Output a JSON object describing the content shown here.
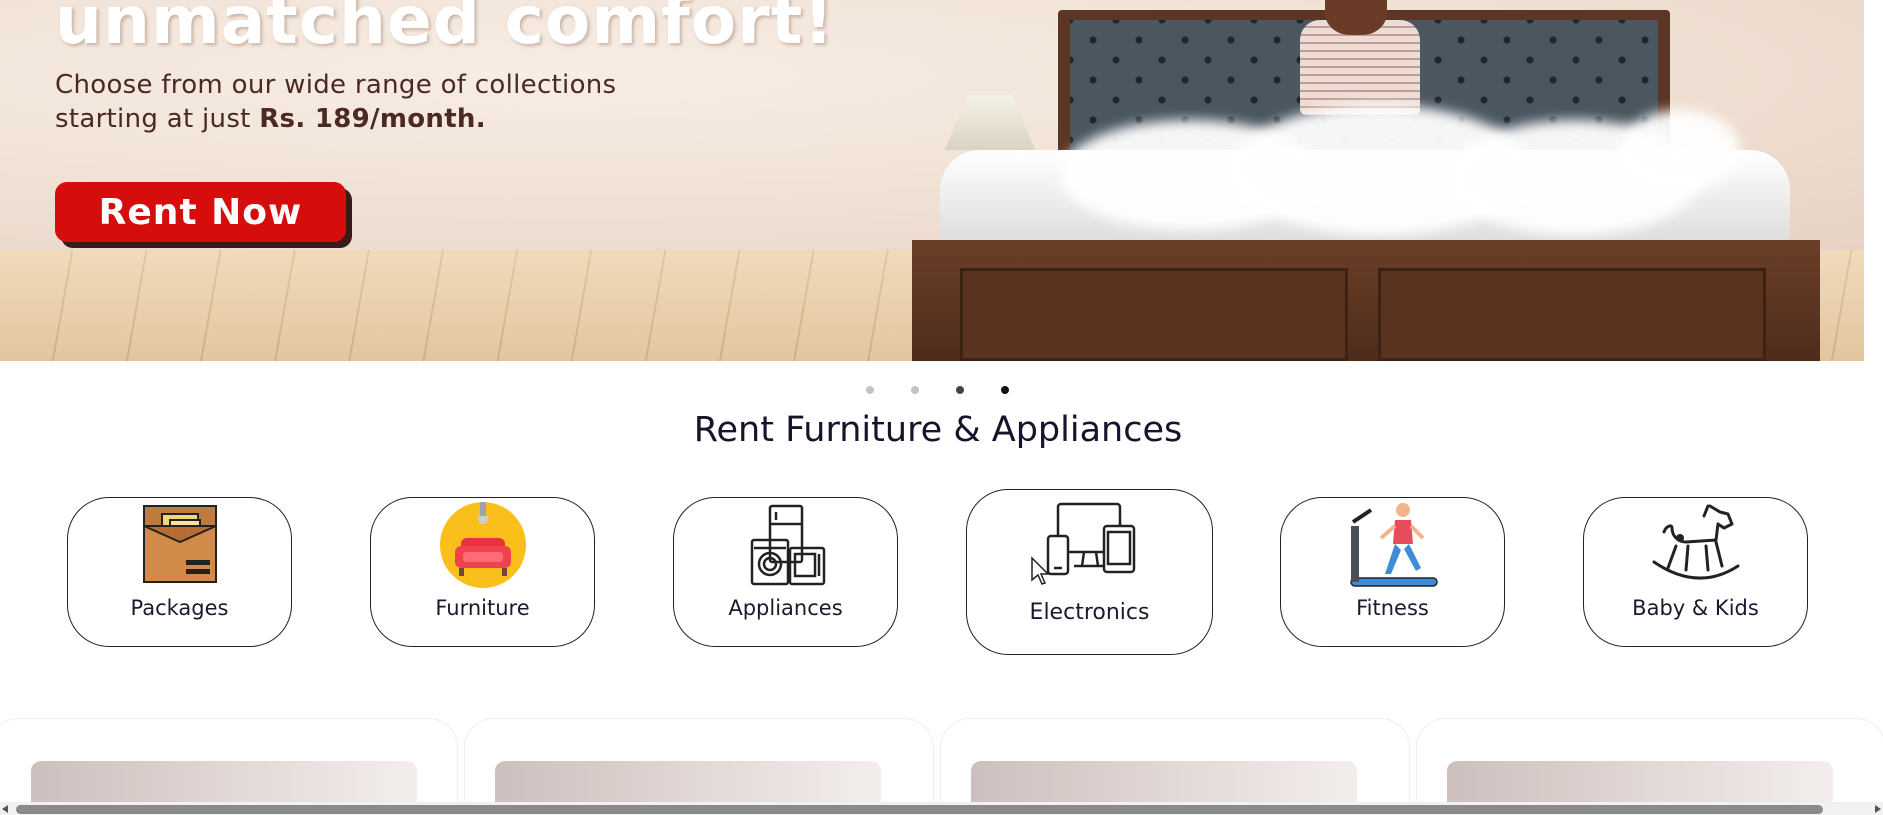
{
  "hero": {
    "title": "unmatched comfort!",
    "subtitle_line1": "Choose from our wide range of collections",
    "subtitle_line2_prefix": "starting at just ",
    "subtitle_line2_price": "Rs. 189/month.",
    "cta_label": "Rent Now"
  },
  "carousel": {
    "slide_count": 4,
    "active_index": 3
  },
  "section": {
    "title": "Rent Furniture & Appliances"
  },
  "categories": [
    {
      "label": "Packages",
      "icon": "package-box-icon"
    },
    {
      "label": "Furniture",
      "icon": "sofa-icon"
    },
    {
      "label": "Appliances",
      "icon": "appliances-icon"
    },
    {
      "label": "Electronics",
      "icon": "devices-icon"
    },
    {
      "label": "Fitness",
      "icon": "treadmill-icon"
    },
    {
      "label": "Baby & Kids",
      "icon": "rocking-horse-icon"
    }
  ],
  "colors": {
    "cta": "#d60d0d",
    "text": "#14142b"
  }
}
